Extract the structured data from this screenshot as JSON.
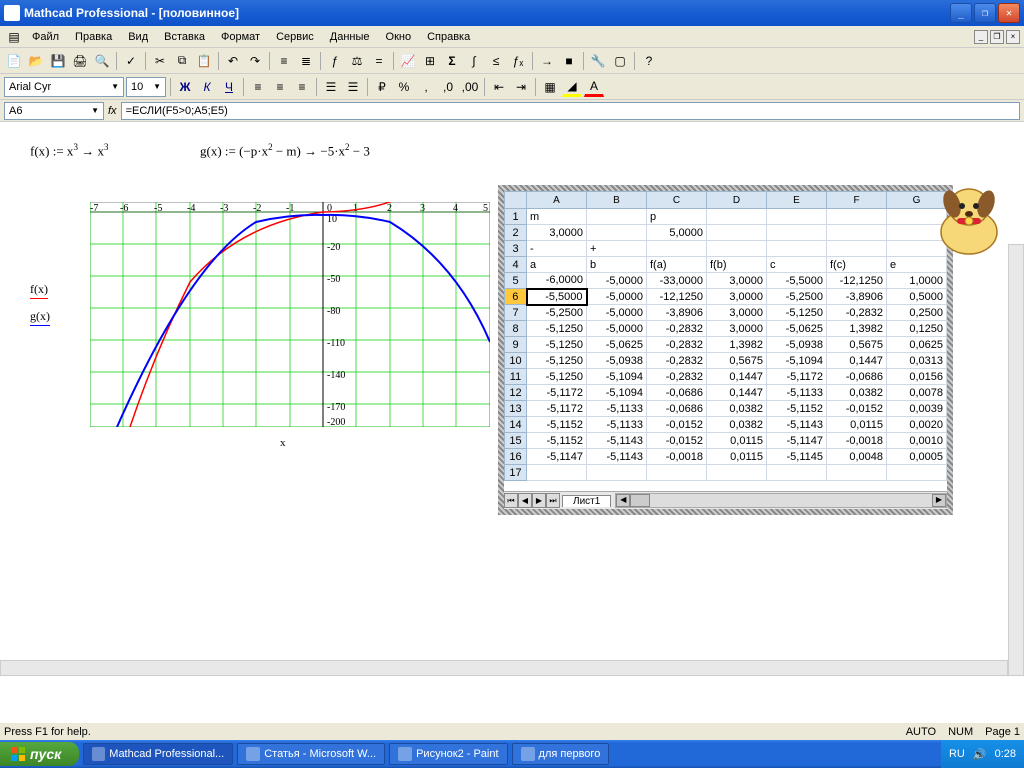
{
  "title": "Mathcad Professional - [половинное]",
  "menubar": [
    "Файл",
    "Правка",
    "Вид",
    "Вставка",
    "Формат",
    "Сервис",
    "Данные",
    "Окно",
    "Справка"
  ],
  "font_name": "Arial Cyr",
  "font_size": "10",
  "cell_ref": "A6",
  "formula": "=ЕСЛИ(F5>0;A5;E5)",
  "eqn_f": "f(x) := x³ → x³",
  "eqn_g": "g(x) := (−p·x² − m) → −5·x² − 3",
  "legend": {
    "fx": "f(x)",
    "gx": "g(x)"
  },
  "chart_xlabel": "x",
  "sheet_tab": "Лист1",
  "status_left": "Press F1 for help.",
  "status_auto": "AUTO",
  "status_num": "NUM",
  "status_page": "Page 1",
  "start": "пуск",
  "taskbar": [
    "Mathcad Professional...",
    "Статья - Microsoft W...",
    "Рисунок2 - Paint",
    "для первого"
  ],
  "tray_lang": "RU",
  "tray_time": "0:28",
  "excel_cols": [
    "A",
    "B",
    "C",
    "D",
    "E",
    "F",
    "G"
  ],
  "excel_rows": [
    {
      "n": "1",
      "c": [
        "m",
        "",
        "p",
        "",
        "",
        "",
        ""
      ],
      "txt": true
    },
    {
      "n": "2",
      "c": [
        "3,0000",
        "",
        "5,0000",
        "",
        "",
        "",
        ""
      ]
    },
    {
      "n": "3",
      "c": [
        "-",
        "+",
        "",
        "",
        "",
        "",
        ""
      ],
      "txt": true
    },
    {
      "n": "4",
      "c": [
        "a",
        "b",
        "f(a)",
        "f(b)",
        "c",
        "f(c)",
        "e"
      ],
      "txt": true
    },
    {
      "n": "5",
      "c": [
        "-6,0000",
        "-5,0000",
        "-33,0000",
        "3,0000",
        "-5,5000",
        "-12,1250",
        "1,0000"
      ]
    },
    {
      "n": "6",
      "c": [
        "-5,5000",
        "-5,0000",
        "-12,1250",
        "3,0000",
        "-5,2500",
        "-3,8906",
        "0,5000"
      ],
      "sel": true
    },
    {
      "n": "7",
      "c": [
        "-5,2500",
        "-5,0000",
        "-3,8906",
        "3,0000",
        "-5,1250",
        "-0,2832",
        "0,2500"
      ]
    },
    {
      "n": "8",
      "c": [
        "-5,1250",
        "-5,0000",
        "-0,2832",
        "3,0000",
        "-5,0625",
        "1,3982",
        "0,1250"
      ]
    },
    {
      "n": "9",
      "c": [
        "-5,1250",
        "-5,0625",
        "-0,2832",
        "1,3982",
        "-5,0938",
        "0,5675",
        "0,0625"
      ]
    },
    {
      "n": "10",
      "c": [
        "-5,1250",
        "-5,0938",
        "-0,2832",
        "0,5675",
        "-5,1094",
        "0,1447",
        "0,0313"
      ]
    },
    {
      "n": "11",
      "c": [
        "-5,1250",
        "-5,1094",
        "-0,2832",
        "0,1447",
        "-5,1172",
        "-0,0686",
        "0,0156"
      ]
    },
    {
      "n": "12",
      "c": [
        "-5,1172",
        "-5,1094",
        "-0,0686",
        "0,1447",
        "-5,1133",
        "0,0382",
        "0,0078"
      ]
    },
    {
      "n": "13",
      "c": [
        "-5,1172",
        "-5,1133",
        "-0,0686",
        "0,0382",
        "-5,1152",
        "-0,0152",
        "0,0039"
      ]
    },
    {
      "n": "14",
      "c": [
        "-5,1152",
        "-5,1133",
        "-0,0152",
        "0,0382",
        "-5,1143",
        "0,0115",
        "0,0020"
      ]
    },
    {
      "n": "15",
      "c": [
        "-5,1152",
        "-5,1143",
        "-0,0152",
        "0,0115",
        "-5,1147",
        "-0,0018",
        "0,0010"
      ]
    },
    {
      "n": "16",
      "c": [
        "-5,1147",
        "-5,1143",
        "-0,0018",
        "0,0115",
        "-5,1145",
        "0,0048",
        "0,0005"
      ]
    },
    {
      "n": "17",
      "c": [
        "",
        "",
        "",
        "",
        "",
        "",
        ""
      ]
    }
  ],
  "chart_data": {
    "type": "line",
    "xlabel": "x",
    "x_range": [
      -7,
      5
    ],
    "y_range": [
      -200,
      10
    ],
    "x_ticks": [
      -7,
      -6,
      -5,
      -4,
      -3,
      -2,
      -1,
      0,
      1,
      2,
      3,
      4,
      5
    ],
    "y_ticks": [
      10,
      -20,
      -50,
      -80,
      -110,
      -140,
      -170,
      -200
    ],
    "series": [
      {
        "name": "f(x)",
        "color": "#ff0000",
        "expr": "x^3",
        "x": [
          -5.8,
          -5,
          -4,
          -3,
          -2,
          -1,
          0,
          1,
          2,
          3,
          4
        ],
        "y": [
          -195,
          -125,
          -64,
          -27,
          -8,
          -1,
          0,
          1,
          8,
          27,
          64
        ]
      },
      {
        "name": "g(x)",
        "color": "#0000ff",
        "expr": "-5x^2-3",
        "x": [
          -6.2,
          -5,
          -4,
          -3,
          -2,
          -1,
          0,
          1,
          2,
          3,
          4,
          5
        ],
        "y": [
          -195,
          -128,
          -83,
          -48,
          -23,
          -8,
          -3,
          -8,
          -23,
          -48,
          -83,
          -128
        ]
      }
    ]
  }
}
